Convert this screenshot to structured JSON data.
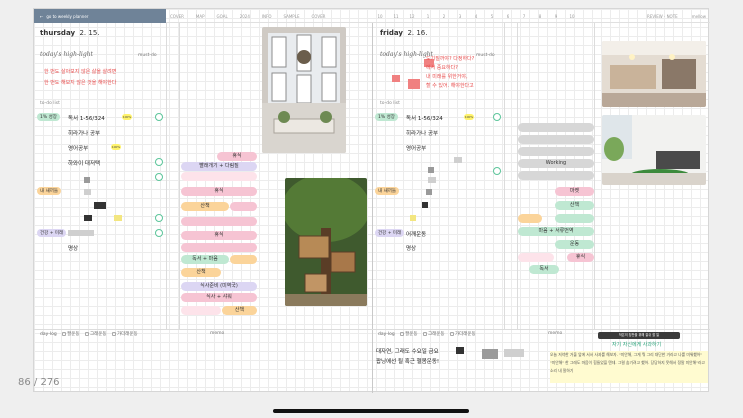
{
  "topbar": {
    "back_label": "go to weekly planner",
    "nav": [
      "COVER",
      "MAP",
      "GOAL",
      "2024",
      "INFO",
      "SAMPLE",
      "COVER"
    ],
    "date_numbers": [
      "10",
      "11",
      "12",
      "1",
      "2",
      "3",
      "4",
      "5",
      "6",
      "7",
      "8",
      "9",
      "10"
    ],
    "right": [
      "REVIEW · NOTE",
      "mellow"
    ]
  },
  "left_day": {
    "day": "thursday",
    "date": "2. 15.",
    "highlight_label": "today's high-light",
    "mustdo_label": "must-do",
    "highlights": [
      "한 번도 살아보지 않은 삶을 살려면",
      "한 번도 해보지 않은 것을 해야한다"
    ],
    "todo_label": "to-do list",
    "tasks": [
      {
        "tag": "1% 성장",
        "text": "독서 1-56/324",
        "badge": "100%"
      },
      {
        "tag": "",
        "text": "히라가나 공부"
      },
      {
        "tag": "",
        "text": "영어공부",
        "badge": "100%"
      },
      {
        "tag": "",
        "text": "하와이 대저택"
      },
      {
        "tag": "내 새끼들",
        "text": ""
      },
      {
        "tag": "건강 + 미래",
        "text": ""
      },
      {
        "tag": "",
        "text": "명상"
      }
    ]
  },
  "left_timeline": [
    "휴식",
    "빨래개기 + 다림질",
    "휴식",
    "산책",
    "휴식",
    "독서 + 마음",
    "산책",
    "식사준비 (미역국)",
    "식사 + 샤워",
    "산책"
  ],
  "right_day": {
    "day": "friday",
    "date": "2. 16.",
    "highlight_label": "today's high-light",
    "mustdo_label": "must-do",
    "highlights": [
      "도기질까야? 다정하다?",
      "에서 중요하다?",
      "내 미래를 위한거야,",
      "할 수 있어. 해야한다고"
    ],
    "todo_label": "to-do list",
    "tasks": [
      {
        "tag": "1% 성장",
        "text": "독서 1-56/324",
        "badge": "100%"
      },
      {
        "tag": "",
        "text": "히라가나 공부"
      },
      {
        "tag": "",
        "text": "영어공부"
      },
      {
        "tag": "내 새끼들",
        "text": ""
      },
      {
        "tag": "건강 + 미래",
        "text": "어깨운동"
      },
      {
        "tag": "",
        "text": "명상"
      }
    ]
  },
  "right_timeline": [
    "Working",
    "마켓",
    "산책",
    "마음 + 서류번역",
    "운동",
    "휴식",
    "독서"
  ],
  "bottom": {
    "daylog_label": "day-log",
    "checks": [
      "팔운동",
      "그래운동",
      "가더래운동"
    ],
    "memo_label": "memo",
    "right_log": [
      "대자연, 그래도 수요일 금요",
      "팝닝에선 될 혹근 헬몸운동!"
    ],
    "memo_box_label": "작은의 칭찬을 위해 잘쉬 할 일",
    "memo_title": "자기 자신에게 사과하기",
    "memo_body": "오늘 저녁한 거울 앞에 서서 사과를 해보자. \"미안해, 그게 뭐 그리 대단한 거라고 나를 미워했어\" \"미안해\" 한 그래도 마음이 힘들었을 텐데. 그럴 숨기려고 했어. 당당하지 못해서 정말 미안해\"라고 소리 내 말하기"
  },
  "page_counter": "86 / 276",
  "colors": {
    "accent": "#6f8398",
    "red": "#e84c4c",
    "green": "#5cc59a",
    "pink": "#f6c4d3"
  }
}
